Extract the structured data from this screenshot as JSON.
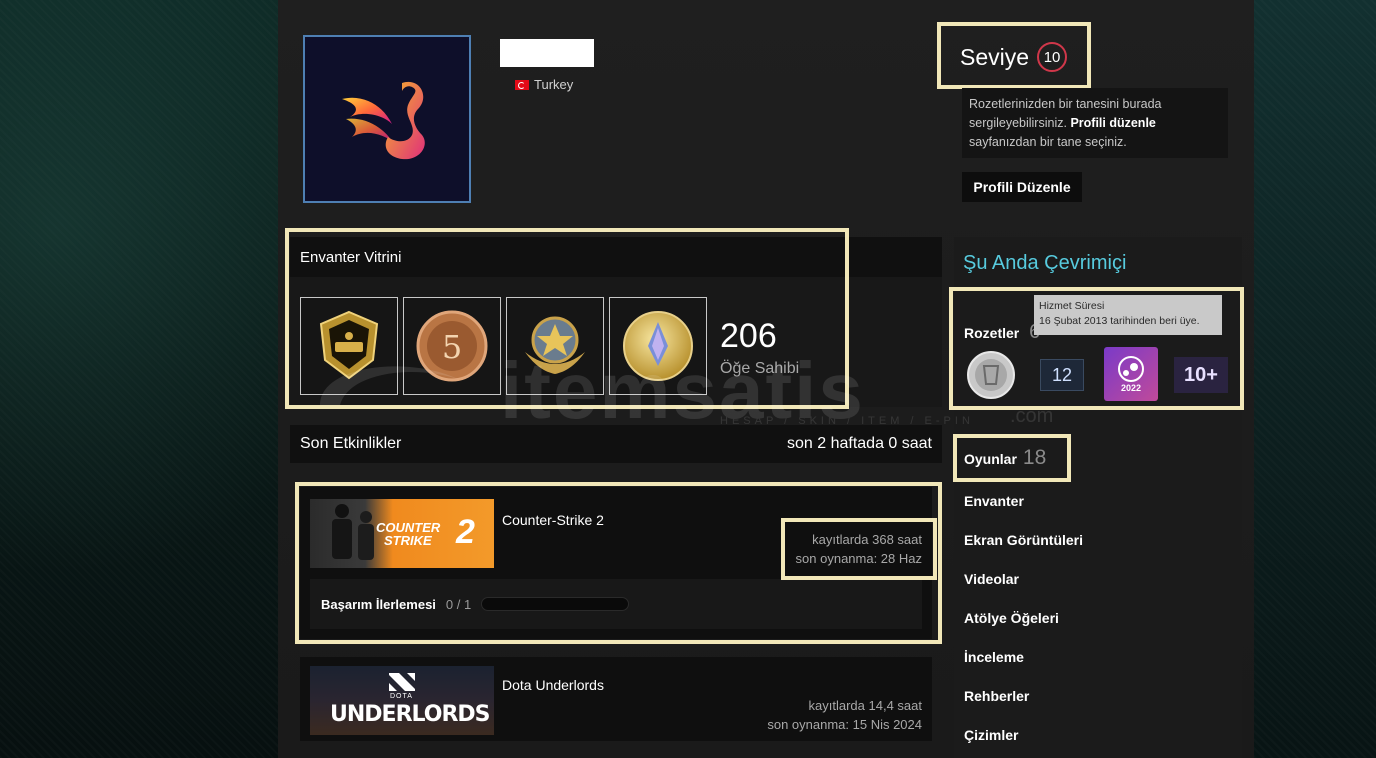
{
  "profile": {
    "country": "Turkey"
  },
  "level": {
    "label": "Seviye",
    "value": "10"
  },
  "showcase_note": {
    "text1": "Rozetlerinizden bir tanesini burada sergileyebilirsiniz.",
    "link": "Profili düzenle",
    "text2": "sayfanızdan bir tane seçiniz."
  },
  "edit_button": "Profili Düzenle",
  "inventory": {
    "title": "Envanter Vitrini",
    "count": "206",
    "label": "Öğe Sahibi",
    "items": [
      "CS:GO Medal",
      "5 Year Veteran Coin",
      "Service Medal",
      "Counter-Strike Coin"
    ]
  },
  "activity": {
    "title": "Son Etkinlikler",
    "summary": "son 2 haftada 0 saat",
    "games": [
      {
        "name": "Counter-Strike 2",
        "hours": "kayıtlarda 368 saat",
        "last_played": "son oynanma: 28 Haz",
        "achievement_label": "Başarım İlerlemesi",
        "achievement_value": "0 / 1",
        "achievement_progress": 0,
        "capsule_text_1": "COUNTER",
        "capsule_text_2": "STRIKE",
        "capsule_text_3": "2"
      },
      {
        "name": "Dota Underlords",
        "hours": "kayıtlarda 14,4 saat",
        "last_played": "son oynanma: 15 Nis 2024",
        "capsule_text_1": "DOTA",
        "capsule_text_2": "UNDERLORDS"
      }
    ]
  },
  "sidebar": {
    "online_status": "Şu Anda Çevrimiçi",
    "badges_label": "Rozetler",
    "badges_count_partial": "6",
    "tooltip_title": "Hizmet Süresi",
    "tooltip_text": "16 Şubat 2013 tarihinden beri üye.",
    "badge_years": "12",
    "badge_steam_year": "2022",
    "badge_plus": "10+",
    "games_label": "Oyunlar",
    "games_count": "18",
    "links": [
      "Envanter",
      "Ekran Görüntüleri",
      "Videolar",
      "Atölye Öğeleri",
      "İnceleme",
      "Rehberler",
      "Çizimler"
    ]
  },
  "watermark": {
    "brand": "itemsatis",
    "tagline": "HESAP / SKIN / ITEM / E-PIN",
    "domain": ".com"
  },
  "colors": {
    "highlight": "#f1e7b8",
    "online": "#57cbde",
    "level_ring": "#d0374a",
    "avatar_border": "#4e7fb3"
  }
}
